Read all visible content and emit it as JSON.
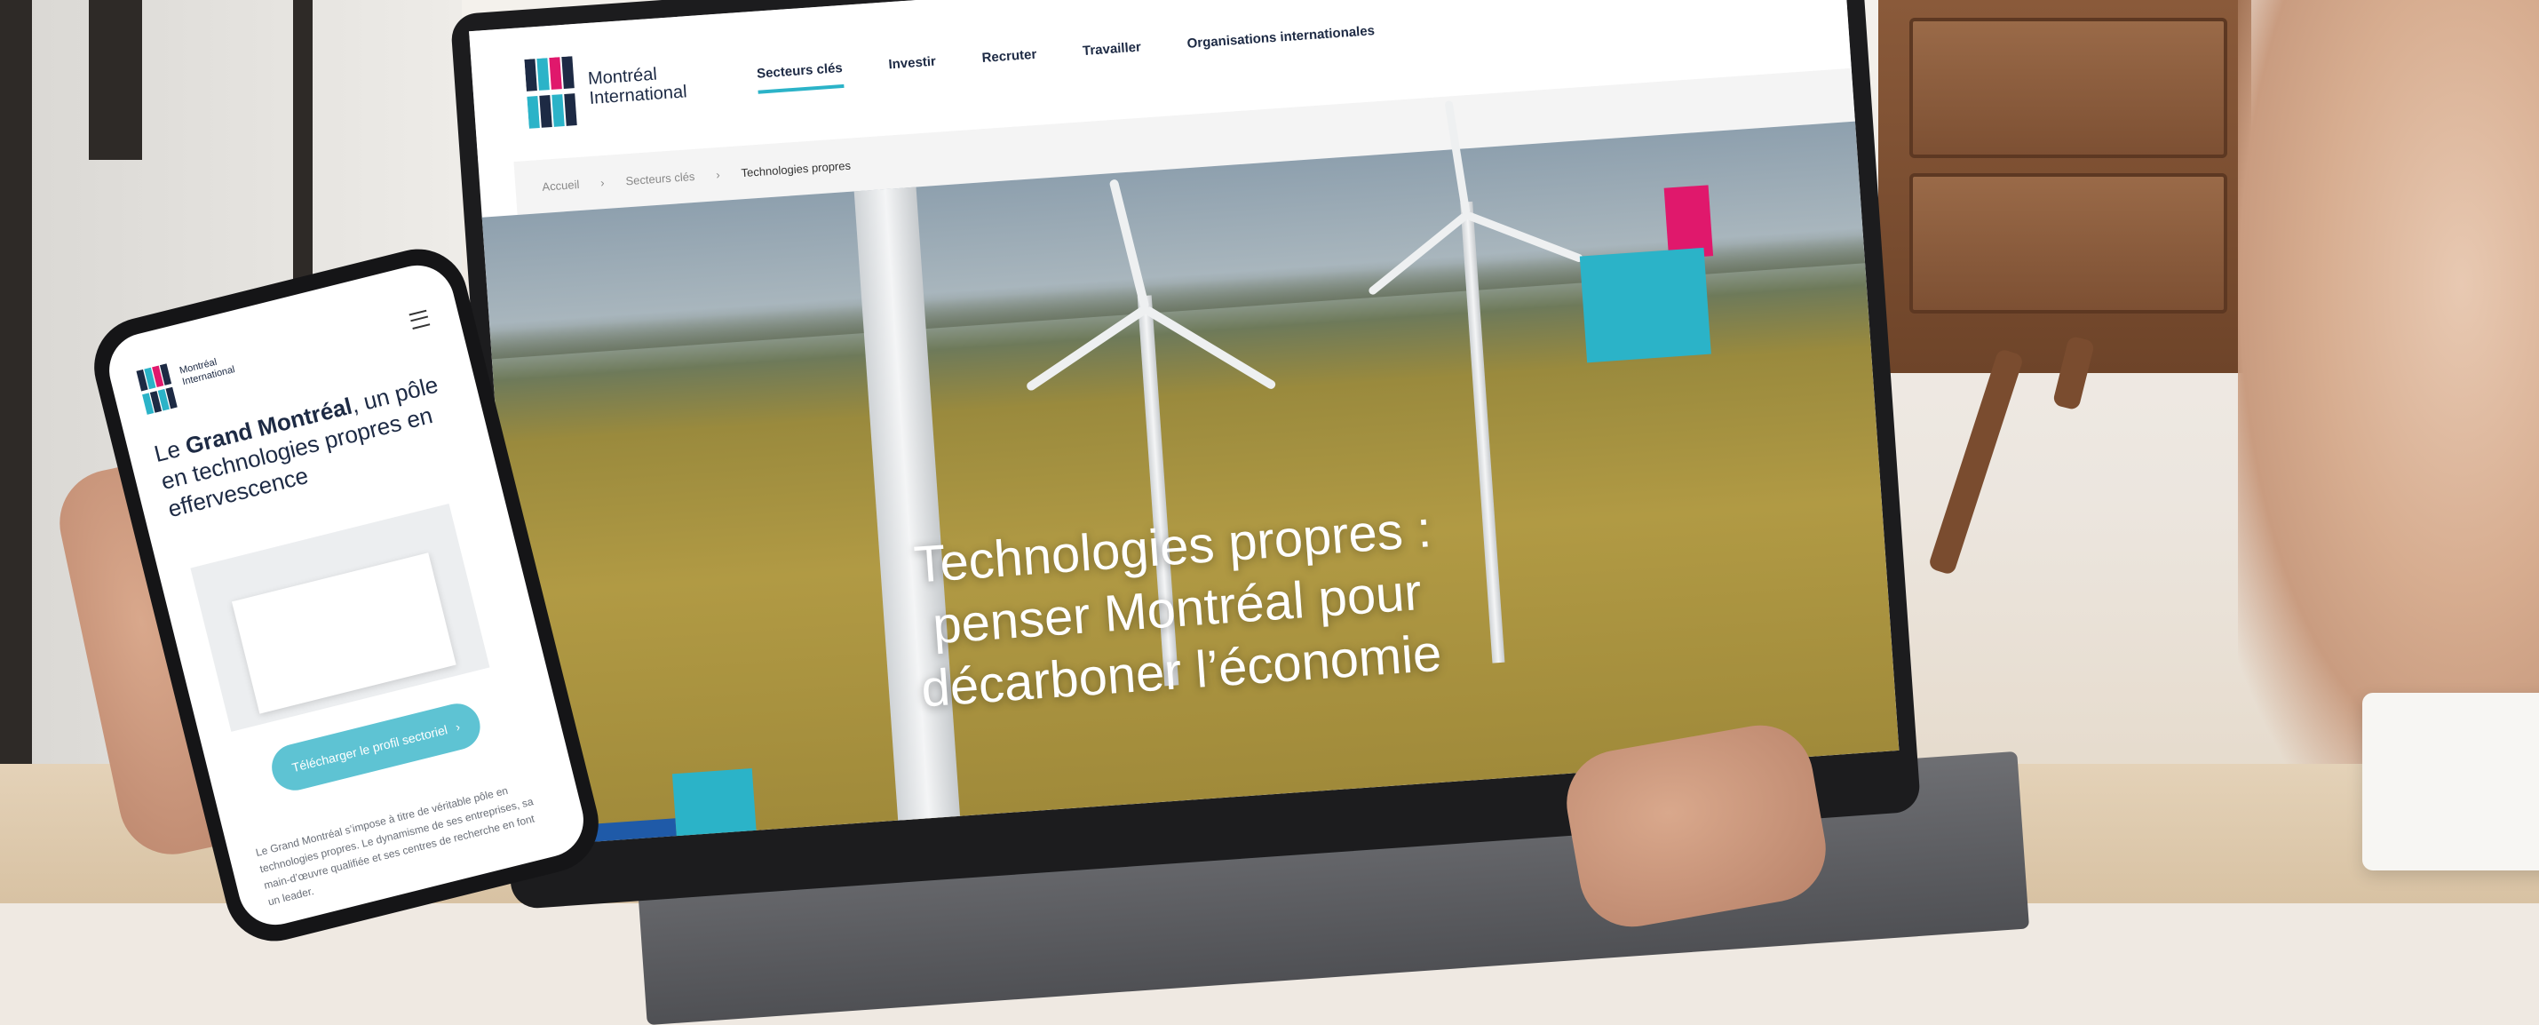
{
  "laptop_site": {
    "logo_text_line1": "Montréal",
    "logo_text_line2": "International",
    "nav": [
      "Secteurs clés",
      "Investir",
      "Recruter",
      "Travailler",
      "Organisations internationales"
    ],
    "breadcrumb": [
      "Accueil",
      "Secteurs clés",
      "Technologies propres"
    ],
    "hero_title": "Technologies propres : penser Montréal pour décarboner l’économie"
  },
  "phone_site": {
    "logo_text_line1": "Montréal",
    "logo_text_line2": "International",
    "headline_prefix": "Le ",
    "headline_bold": "Grand Montréal",
    "headline_rest": ", un pôle en technologies propres en effervescence",
    "button_label": "Télécharger le profil sectoriel",
    "paragraph": "Le Grand Montréal s’impose à titre de véritable pôle en technologies propres. Le dynamisme de ses entreprises, sa main-d’œuvre qualifiée et ses centres de recherche en font un leader."
  },
  "colors": {
    "brand_navy": "#1d2a44",
    "brand_teal": "#2bb3c8",
    "brand_pink": "#e0186c",
    "square_blue": "#1f5aa8"
  },
  "icons": {
    "menu": "hamburger-icon",
    "arrow": "chevron-right-icon"
  }
}
